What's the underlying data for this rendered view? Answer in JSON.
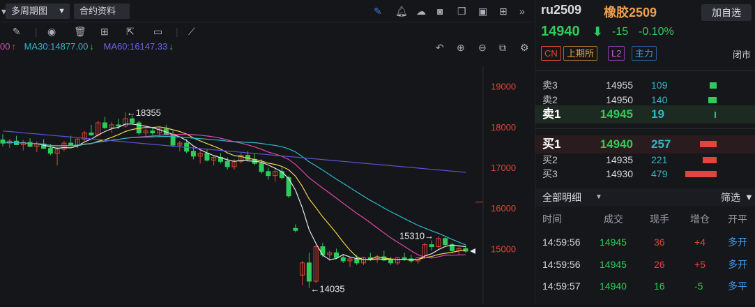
{
  "toolbar": {
    "period_label": "多周期图",
    "contract_label": "合约资料"
  },
  "ma_row": {
    "ma_prefix": "00",
    "ma_prefix_arrow": "↑",
    "ma30": "MA30:14877.00",
    "ma30_arrow": "↓",
    "ma60": "MA60:16147.33",
    "ma60_arrow": "↓"
  },
  "colors": {
    "up": "#e2453a",
    "down": "#2ecc5a",
    "ma5": "#e8e8ea",
    "ma10": "#f3d54a",
    "ma20": "#e04aa8",
    "ma30": "#2fb8c8",
    "ma60": "#5a55d8",
    "accent": "#3d7cf0"
  },
  "chart_data": {
    "type": "candlestick",
    "yticks": [
      "19000",
      "18000",
      "17000",
      "16000",
      "15000"
    ],
    "ylim": [
      13650,
      19750
    ],
    "annotations": {
      "high": "←18355",
      "low": "←14035",
      "recent_high": "15310→"
    },
    "candles": [
      [
        17680,
        17820,
        17520,
        17600
      ],
      [
        17600,
        17700,
        17480,
        17650
      ],
      [
        17650,
        17780,
        17550,
        17560
      ],
      [
        17560,
        17680,
        17420,
        17620
      ],
      [
        17620,
        17720,
        17500,
        17520
      ],
      [
        17520,
        17640,
        17380,
        17580
      ],
      [
        17580,
        17700,
        17460,
        17470
      ],
      [
        17470,
        17580,
        17300,
        17350
      ],
      [
        17350,
        17500,
        17050,
        17450
      ],
      [
        17450,
        17650,
        17400,
        17600
      ],
      [
        17600,
        17780,
        17520,
        17550
      ],
      [
        17550,
        17720,
        17480,
        17700
      ],
      [
        17700,
        17900,
        17650,
        17850
      ],
      [
        17850,
        18050,
        17780,
        17800
      ],
      [
        17800,
        18150,
        17750,
        18100
      ],
      [
        18100,
        18250,
        17950,
        17980
      ],
      [
        17980,
        18120,
        17850,
        18050
      ],
      [
        18050,
        18200,
        17950,
        18020
      ],
      [
        18020,
        18355,
        17980,
        18200
      ],
      [
        18200,
        18280,
        18050,
        18100
      ],
      [
        18100,
        18150,
        17800,
        17850
      ],
      [
        17850,
        17950,
        17750,
        17900
      ],
      [
        17900,
        18000,
        17800,
        17850
      ],
      [
        17850,
        17980,
        17750,
        17950
      ],
      [
        17950,
        18050,
        17800,
        17820
      ],
      [
        17820,
        17900,
        17500,
        17550
      ],
      [
        17550,
        17650,
        17400,
        17600
      ],
      [
        17600,
        17700,
        17350,
        17400
      ],
      [
        17400,
        17500,
        17200,
        17280
      ],
      [
        17280,
        17400,
        17100,
        17350
      ],
      [
        17350,
        17450,
        17150,
        17180
      ],
      [
        17180,
        17300,
        17050,
        17250
      ],
      [
        17250,
        17350,
        17100,
        17150
      ],
      [
        17150,
        17250,
        16950,
        17020
      ],
      [
        17020,
        17200,
        16950,
        17150
      ],
      [
        17150,
        17350,
        17100,
        17300
      ],
      [
        17300,
        17400,
        17150,
        17200
      ],
      [
        17200,
        17350,
        17050,
        17100
      ],
      [
        17100,
        17200,
        16850,
        16900
      ],
      [
        16900,
        17000,
        16700,
        16800
      ],
      [
        16800,
        16950,
        16650,
        16900
      ],
      [
        16900,
        17000,
        16700,
        16750
      ],
      [
        16750,
        16800,
        16250,
        16300
      ],
      [
        15500,
        15600,
        15400,
        15450
      ],
      [
        14350,
        14700,
        14100,
        14650
      ],
      [
        14650,
        14900,
        14035,
        14200
      ],
      [
        14200,
        15100,
        14150,
        15050
      ],
      [
        15050,
        15150,
        14800,
        14850
      ],
      [
        14850,
        14950,
        14700,
        14900
      ],
      [
        14900,
        15000,
        14750,
        14780
      ],
      [
        14780,
        14850,
        14650,
        14700
      ],
      [
        14700,
        14800,
        14550,
        14750
      ],
      [
        14750,
        14850,
        14600,
        14650
      ],
      [
        14650,
        14800,
        14600,
        14780
      ],
      [
        14780,
        14900,
        14700,
        14750
      ],
      [
        14750,
        14850,
        14650,
        14800
      ],
      [
        14800,
        14950,
        14700,
        14720
      ],
      [
        14720,
        14800,
        14600,
        14650
      ],
      [
        14650,
        14800,
        14600,
        14780
      ],
      [
        14780,
        14900,
        14700,
        14750
      ],
      [
        14750,
        14850,
        14650,
        14700
      ],
      [
        14700,
        14800,
        14620,
        14780
      ],
      [
        14780,
        15150,
        14750,
        15100
      ],
      [
        15100,
        15200,
        14950,
        15050
      ],
      [
        15050,
        15310,
        15000,
        15250
      ],
      [
        15250,
        15280,
        15050,
        15100
      ],
      [
        15100,
        15150,
        14900,
        14950
      ],
      [
        14950,
        15050,
        14850,
        15000
      ],
      [
        15000,
        15080,
        14900,
        14940
      ]
    ]
  },
  "quote": {
    "code": "ru2509",
    "name": "橡胶2509",
    "add_label": "加自选",
    "price": "14940",
    "price_arrow": "⬇",
    "change": "-15",
    "change_pct": "-0.10%",
    "tag_cn": "CN",
    "tag_exchange": "上期所",
    "tag_l2": "L2",
    "tag_main": "主力",
    "status": "闭市"
  },
  "orderbook": {
    "asks": [
      {
        "label": "卖3",
        "price": "14955",
        "vol": "109"
      },
      {
        "label": "卖2",
        "price": "14950",
        "vol": "140"
      },
      {
        "label": "卖1",
        "price": "14945",
        "vol": "19"
      }
    ],
    "bids": [
      {
        "label": "买1",
        "price": "14940",
        "vol": "257"
      },
      {
        "label": "买2",
        "price": "14935",
        "vol": "221"
      },
      {
        "label": "买3",
        "price": "14930",
        "vol": "479"
      }
    ]
  },
  "details": {
    "title": "全部明细",
    "filter_label": "筛选",
    "headers": [
      "时间",
      "成交",
      "现手",
      "增仓",
      "开平"
    ],
    "rows": [
      {
        "time": "14:59:56",
        "price": "14945",
        "qty": "36",
        "oi": "+4",
        "type": "多开"
      },
      {
        "time": "14:59:56",
        "price": "14945",
        "qty": "26",
        "oi": "+5",
        "type": "多开"
      },
      {
        "time": "14:59:57",
        "price": "14940",
        "qty": "16",
        "oi": "-5",
        "type": "多平"
      }
    ]
  }
}
